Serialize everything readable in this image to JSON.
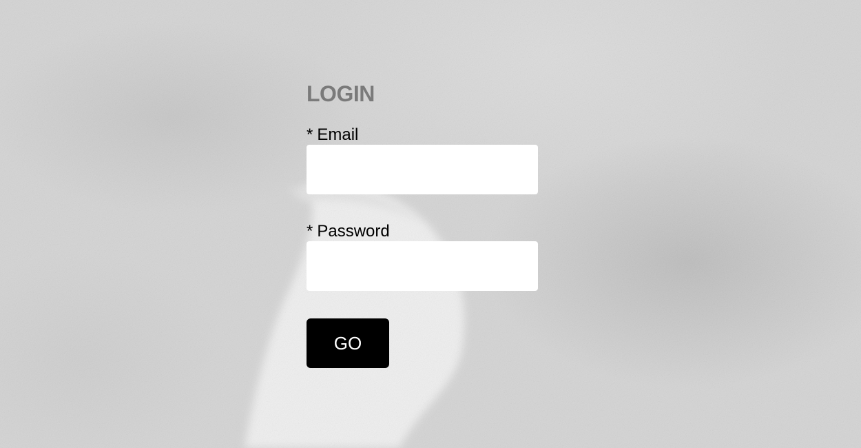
{
  "login": {
    "title": "LOGIN",
    "required_marker": "*",
    "email_label": "Email",
    "email_value": "",
    "password_label": "Password",
    "password_value": "",
    "submit_label": "GO"
  },
  "colors": {
    "title": "#7a7a7a",
    "button_bg": "#000000",
    "button_text": "#ffffff",
    "input_bg": "#ffffff",
    "background": "#d4d4d4"
  }
}
